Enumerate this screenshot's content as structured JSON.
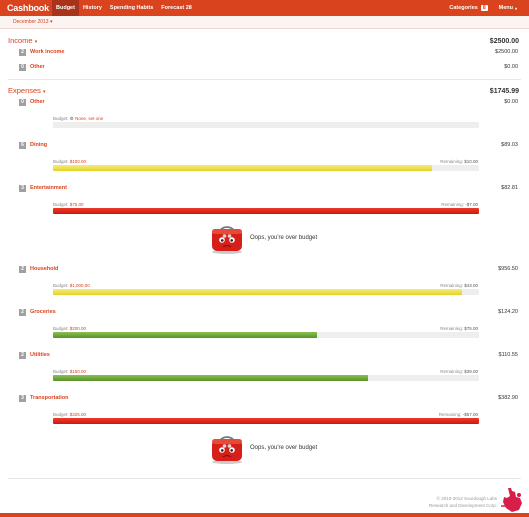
{
  "app": {
    "title": "Cashbook"
  },
  "nav": {
    "items": [
      {
        "label": "Budget",
        "active": true
      },
      {
        "label": "History",
        "active": false
      },
      {
        "label": "Spending Habits",
        "active": false
      },
      {
        "label": "Forecast 28",
        "active": false
      }
    ],
    "categories_label": "Categories",
    "categories_count": "8",
    "menu_label": "Menu",
    "dropdown_icon": "chevron-down-icon"
  },
  "period": {
    "label": "December 2013",
    "caret": "▾"
  },
  "income": {
    "title": "Income",
    "caret": "▾",
    "total": "$2500.00",
    "rows": [
      {
        "count": "2",
        "name": "Work income",
        "amount": "$2500.00"
      },
      {
        "count": "0",
        "name": "Other",
        "amount": "$0.00"
      }
    ]
  },
  "expenses": {
    "title": "Expenses",
    "caret": "▾",
    "total": "$1745.99",
    "budget_label": "Budget:",
    "remaining_label": "Remaining:",
    "rows": [
      {
        "count": "0",
        "name": "Other",
        "amount": "$0.00",
        "budget": "None, set one",
        "budget_icon": "settings-icon",
        "remaining": "",
        "fill_fraction": 0,
        "bar_color": "none"
      },
      {
        "count": "6",
        "name": "Dining",
        "amount": "$89.03",
        "budget": "$100.00",
        "remaining": "$10.00",
        "fill_fraction": 0.89,
        "bar_color": "yellow"
      },
      {
        "count": "3",
        "name": "Entertainment",
        "amount": "$82.81",
        "budget": "$75.00",
        "remaining": "-$7.00",
        "fill_fraction": 1.0,
        "bar_color": "red"
      },
      {
        "count": "2",
        "name": "Household",
        "amount": "$956.50",
        "budget": "$1,000.00",
        "remaining": "$43.00",
        "fill_fraction": 0.96,
        "bar_color": "yellow"
      },
      {
        "count": "2",
        "name": "Groceries",
        "amount": "$124.20",
        "budget": "$200.00",
        "remaining": "$75.00",
        "fill_fraction": 0.62,
        "bar_color": "green"
      },
      {
        "count": "2",
        "name": "Utilities",
        "amount": "$110.55",
        "budget": "$150.00",
        "remaining": "$39.00",
        "fill_fraction": 0.74,
        "bar_color": "green"
      },
      {
        "count": "3",
        "name": "Transportation",
        "amount": "$382.90",
        "budget": "$325.00",
        "remaining": "-$57.00",
        "fill_fraction": 1.0,
        "bar_color": "red"
      }
    ],
    "over_budget_message": "Oops, you're over budget",
    "over_budget_icon": "sad-purse-icon"
  },
  "footer": {
    "copyright_line1": "© 2010-2012 Sourdough Labs",
    "copyright_line2": "Research and Development Corp.",
    "logo_icon": "hand-logo-icon"
  },
  "colors": {
    "brand": "#d9431d",
    "brand_dark": "#a8321a",
    "yellow": "#e3d22a",
    "red": "#d9231a",
    "green": "#6ea33a"
  }
}
